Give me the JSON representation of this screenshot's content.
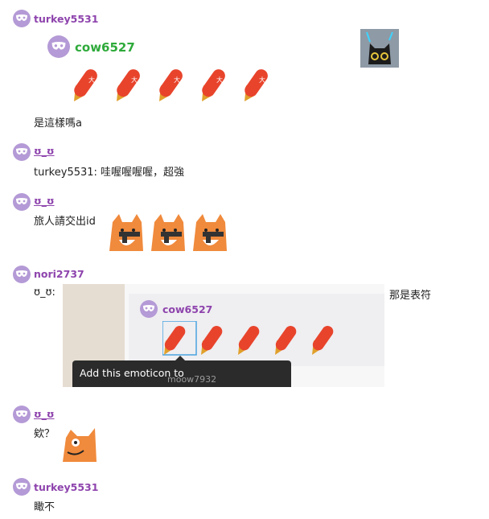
{
  "messages": [
    {
      "user": "turkey5531",
      "quote_user": "cow6527",
      "text": "是這樣嗎a"
    },
    {
      "user": "ʊ_ʊ",
      "text": "turkey5531: 哇喔喔喔喔，超強"
    },
    {
      "user": "ʊ_ʊ",
      "text": "旅人請交出id"
    },
    {
      "user": "nori2737",
      "text_prefix": "ʊ_ʊ:",
      "text_suffix": "那是表符"
    },
    {
      "user": "ʊ_ʊ",
      "text": "欸？"
    },
    {
      "user": "turkey5531",
      "text": "瞰不"
    }
  ],
  "screenshot": {
    "user": "cow6527",
    "tooltip": "Add this emoticon to",
    "hidden_user": "moow7932"
  },
  "emote": {
    "char": "大吉",
    "color": "#e8442c"
  },
  "colors": {
    "username": "#8e44ad",
    "quote_username": "#2eaa3a",
    "avatar": "#b49ad6"
  }
}
